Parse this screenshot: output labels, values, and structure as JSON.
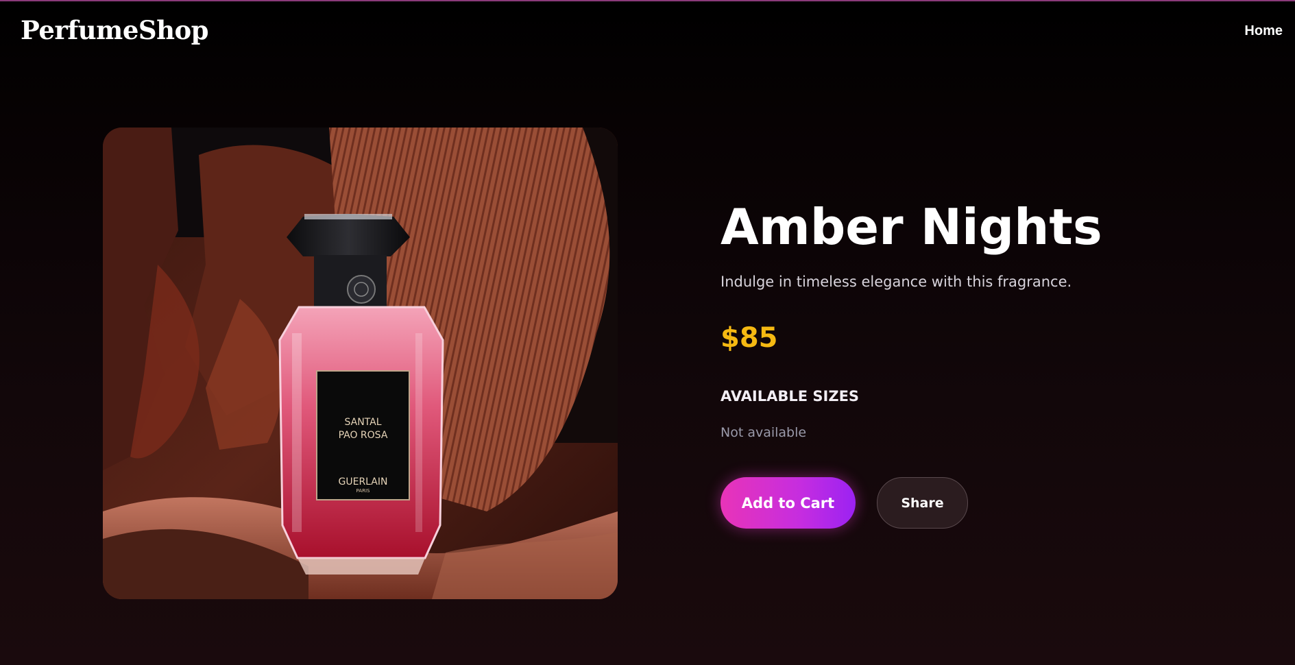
{
  "header": {
    "logo": "PerfumeShop",
    "nav_home": "Home"
  },
  "product": {
    "name": "Amber Nights",
    "description": "Indulge in timeless elegance with this fragrance.",
    "price": "$85",
    "sizes_heading": "AVAILABLE SIZES",
    "sizes_status": "Not available",
    "bottle_label_line1": "SANTAL",
    "bottle_label_line2": "PAO ROSA",
    "bottle_brand": "GUERLAIN",
    "bottle_brand_sub": "PARIS"
  },
  "actions": {
    "add_to_cart": "Add to Cart",
    "share": "Share"
  },
  "colors": {
    "price": "#f5b912",
    "cart_gradient_start": "#e834b8",
    "cart_gradient_end": "#9b22f2",
    "share_bg": "#2b1c1f"
  }
}
